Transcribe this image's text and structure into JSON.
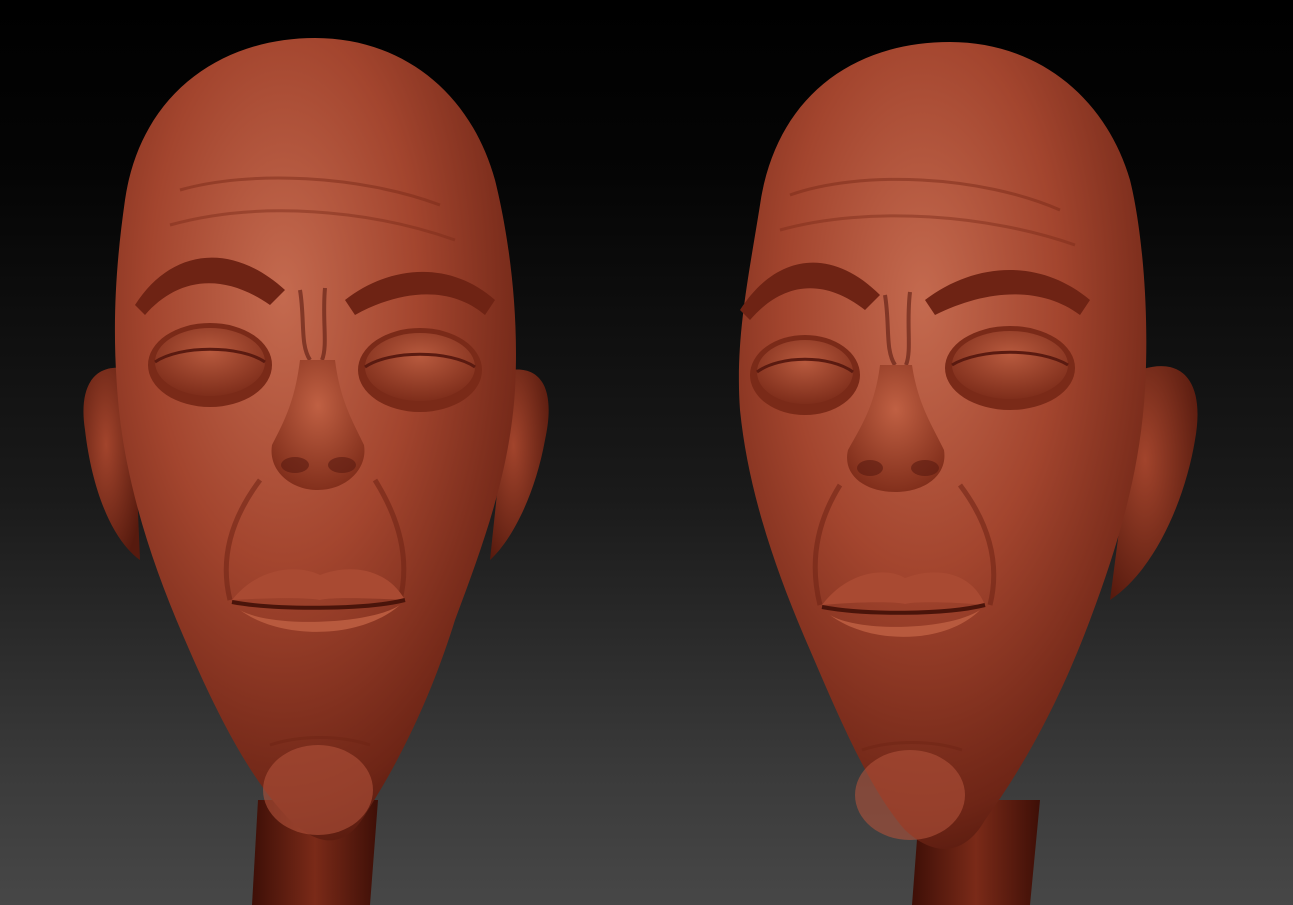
{
  "scene": {
    "background_top": "#000000",
    "background_bottom": "#474747",
    "clay_color": "#a8432c",
    "clay_light": "#c8674a",
    "clay_dark": "#5a1a10",
    "views": [
      {
        "view": "front-left"
      },
      {
        "view": "three-quarter-right"
      }
    ]
  }
}
